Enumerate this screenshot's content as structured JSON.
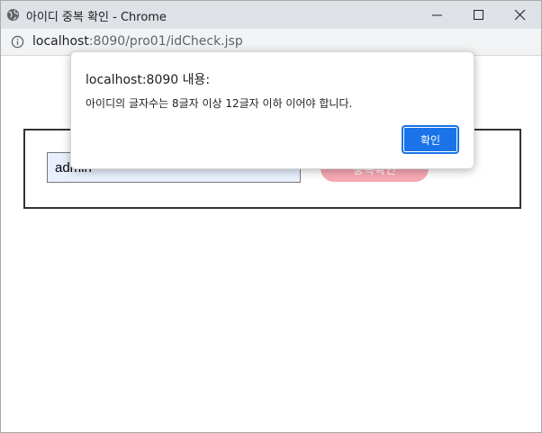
{
  "window": {
    "title": "아이디 중복 확인 - Chrome"
  },
  "address_bar": {
    "host": "localhost",
    "path": ":8090/pro01/idCheck.jsp"
  },
  "form": {
    "id_value": "admin",
    "check_button_label": "중복확인"
  },
  "dialog": {
    "title": "localhost:8090 내용:",
    "message": "아이디의 글자수는 8글자 이상 12글자 이하 이어야 합니다.",
    "confirm_label": "확인",
    "accent_color": "#1a73e8"
  },
  "icons": [
    "globe-icon",
    "minimize-icon",
    "maximize-icon",
    "close-icon",
    "info-icon"
  ]
}
